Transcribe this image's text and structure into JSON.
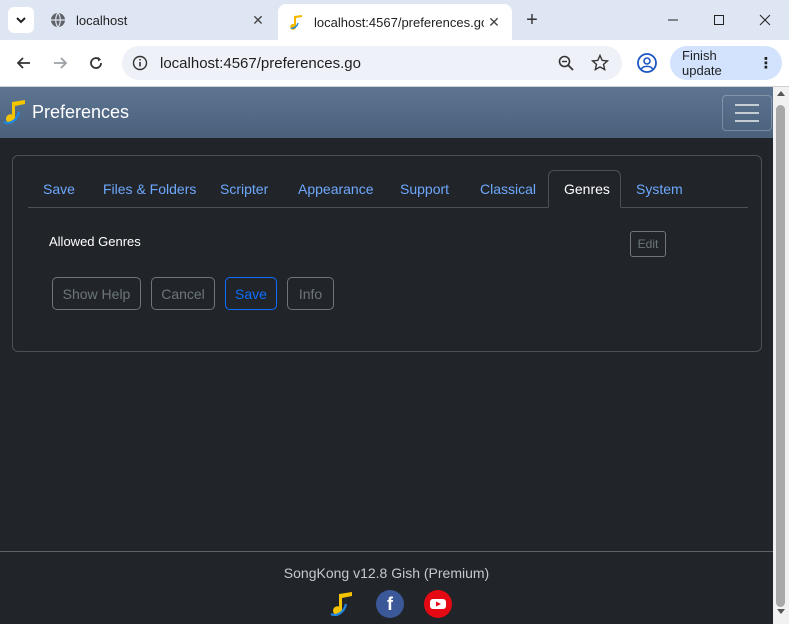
{
  "browser": {
    "tabs": [
      {
        "title": "localhost",
        "active": false
      },
      {
        "title": "localhost:4567/preferences.go",
        "active": true
      }
    ],
    "url": "localhost:4567/preferences.go",
    "finish_update_label": "Finish update"
  },
  "app": {
    "title": "Preferences"
  },
  "preferences": {
    "tabs": [
      {
        "label": "Save"
      },
      {
        "label": "Files & Folders"
      },
      {
        "label": "Scripter"
      },
      {
        "label": "Appearance"
      },
      {
        "label": "Support"
      },
      {
        "label": "Classical"
      },
      {
        "label": "Genres"
      },
      {
        "label": "System"
      }
    ],
    "active_tab": "Genres",
    "allowed_genres_label": "Allowed Genres",
    "edit_label": "Edit",
    "buttons": {
      "show_help": "Show Help",
      "cancel": "Cancel",
      "save": "Save",
      "info": "Info"
    }
  },
  "footer": {
    "version_text": "SongKong v12.8 Gish (Premium)"
  },
  "colors": {
    "background": "#212529",
    "header": "#5d7591",
    "link": "#6ea8fe",
    "primary": "#0d6efd",
    "muted": "#6c757d"
  }
}
